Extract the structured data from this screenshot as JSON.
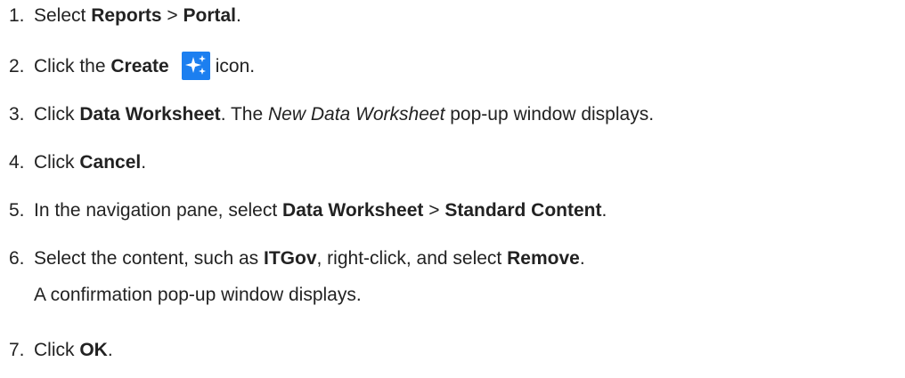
{
  "steps": [
    {
      "num": "1.",
      "parts": [
        "Select ",
        "Reports",
        " > ",
        "Portal",
        "."
      ]
    },
    {
      "num": "2.",
      "parts": [
        "Click the ",
        "Create",
        "icon."
      ],
      "icon": "sparkle-create-icon",
      "icon_color": "#1c7ff0"
    },
    {
      "num": "3.",
      "parts": [
        "Click ",
        "Data Worksheet",
        ". The ",
        "New Data Worksheet",
        " pop-up window displays."
      ]
    },
    {
      "num": "4.",
      "parts": [
        "Click ",
        "Cancel",
        "."
      ]
    },
    {
      "num": "5.",
      "parts": [
        "In the navigation pane, select ",
        "Data Worksheet",
        " > ",
        "Standard Content",
        "."
      ]
    },
    {
      "num": "6.",
      "parts": [
        "Select the content, such as ",
        "ITGov",
        ", right-click, and select ",
        "Remove",
        "."
      ],
      "continuation": "A confirmation pop-up window displays."
    },
    {
      "num": "7.",
      "parts": [
        "Click ",
        "OK",
        "."
      ]
    }
  ]
}
